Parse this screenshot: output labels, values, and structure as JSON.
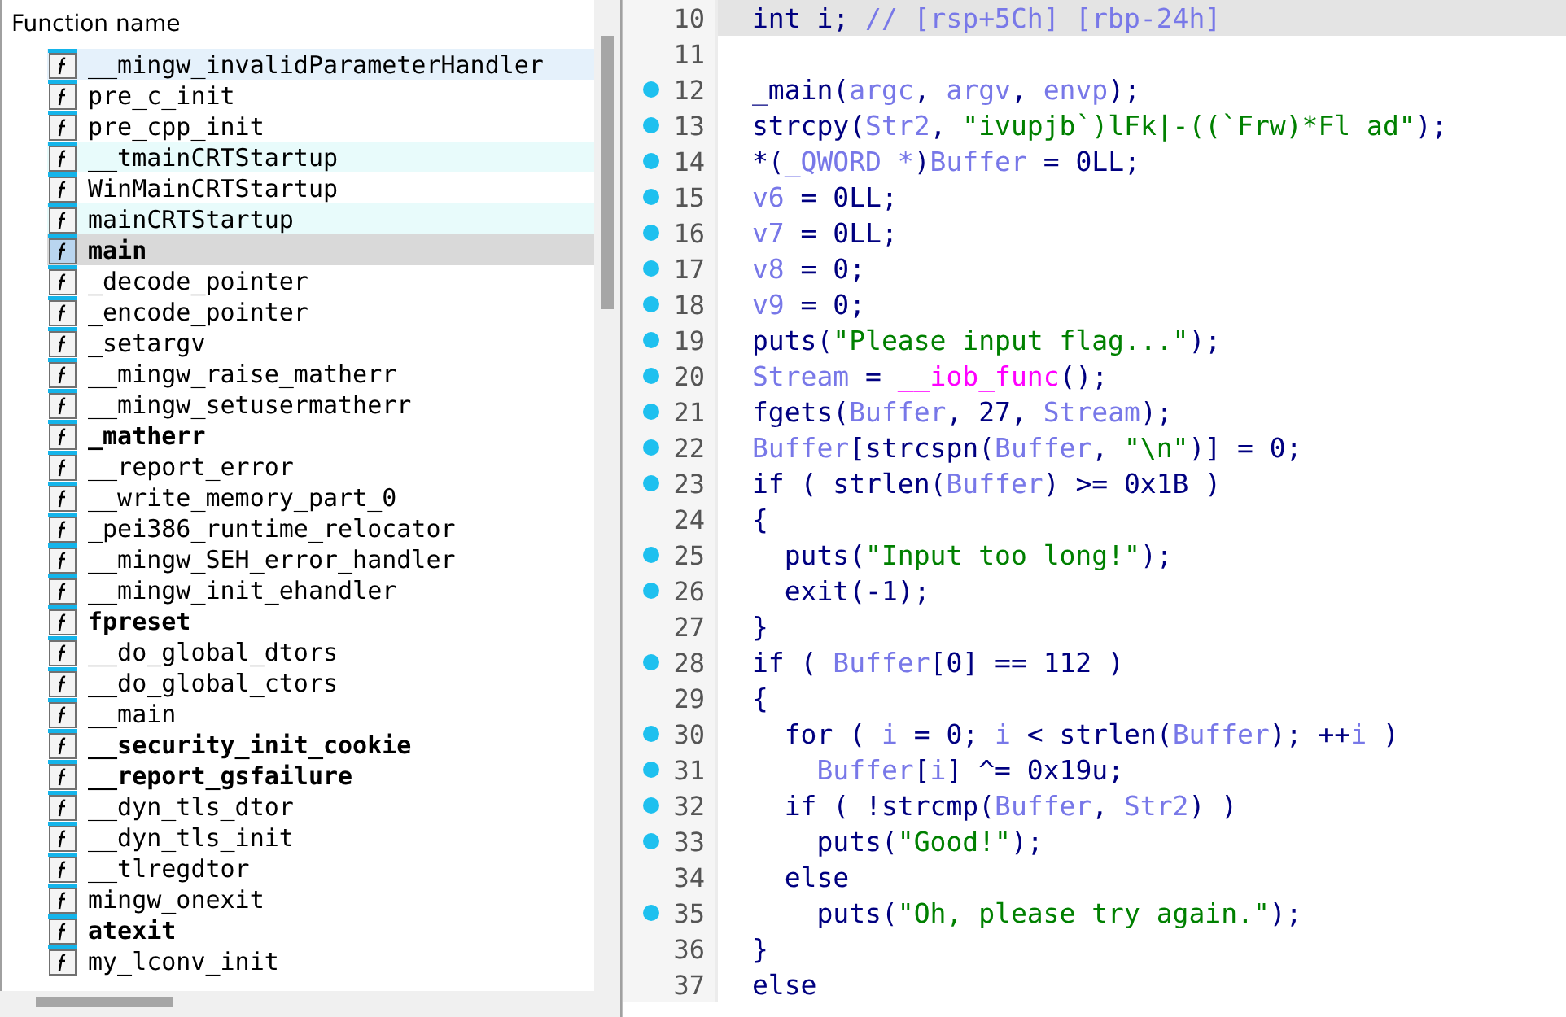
{
  "functions_panel": {
    "header": "Function name",
    "items": [
      {
        "name": "__mingw_invalidParameterHandler",
        "bold": false,
        "selected": false,
        "hovered": true,
        "highlighted": false
      },
      {
        "name": "pre_c_init",
        "bold": false,
        "selected": false,
        "hovered": false,
        "highlighted": false
      },
      {
        "name": "pre_cpp_init",
        "bold": false,
        "selected": false,
        "hovered": false,
        "highlighted": false
      },
      {
        "name": "__tmainCRTStartup",
        "bold": false,
        "selected": false,
        "hovered": false,
        "highlighted": true
      },
      {
        "name": "WinMainCRTStartup",
        "bold": false,
        "selected": false,
        "hovered": false,
        "highlighted": false
      },
      {
        "name": "mainCRTStartup",
        "bold": false,
        "selected": false,
        "hovered": false,
        "highlighted": true
      },
      {
        "name": "main",
        "bold": true,
        "selected": true,
        "hovered": false,
        "highlighted": false
      },
      {
        "name": "_decode_pointer",
        "bold": false,
        "selected": false,
        "hovered": false,
        "highlighted": false
      },
      {
        "name": "_encode_pointer",
        "bold": false,
        "selected": false,
        "hovered": false,
        "highlighted": false
      },
      {
        "name": "_setargv",
        "bold": false,
        "selected": false,
        "hovered": false,
        "highlighted": false
      },
      {
        "name": "__mingw_raise_matherr",
        "bold": false,
        "selected": false,
        "hovered": false,
        "highlighted": false
      },
      {
        "name": "__mingw_setusermatherr",
        "bold": false,
        "selected": false,
        "hovered": false,
        "highlighted": false
      },
      {
        "name": "_matherr",
        "bold": true,
        "selected": false,
        "hovered": false,
        "highlighted": false
      },
      {
        "name": "__report_error",
        "bold": false,
        "selected": false,
        "hovered": false,
        "highlighted": false
      },
      {
        "name": "__write_memory_part_0",
        "bold": false,
        "selected": false,
        "hovered": false,
        "highlighted": false
      },
      {
        "name": "_pei386_runtime_relocator",
        "bold": false,
        "selected": false,
        "hovered": false,
        "highlighted": false
      },
      {
        "name": "__mingw_SEH_error_handler",
        "bold": false,
        "selected": false,
        "hovered": false,
        "highlighted": false
      },
      {
        "name": "__mingw_init_ehandler",
        "bold": false,
        "selected": false,
        "hovered": false,
        "highlighted": false
      },
      {
        "name": "fpreset",
        "bold": true,
        "selected": false,
        "hovered": false,
        "highlighted": false
      },
      {
        "name": "__do_global_dtors",
        "bold": false,
        "selected": false,
        "hovered": false,
        "highlighted": false
      },
      {
        "name": "__do_global_ctors",
        "bold": false,
        "selected": false,
        "hovered": false,
        "highlighted": false
      },
      {
        "name": "__main",
        "bold": false,
        "selected": false,
        "hovered": false,
        "highlighted": false
      },
      {
        "name": "__security_init_cookie",
        "bold": true,
        "selected": false,
        "hovered": false,
        "highlighted": false
      },
      {
        "name": "__report_gsfailure",
        "bold": true,
        "selected": false,
        "hovered": false,
        "highlighted": false
      },
      {
        "name": "__dyn_tls_dtor",
        "bold": false,
        "selected": false,
        "hovered": false,
        "highlighted": false
      },
      {
        "name": "__dyn_tls_init",
        "bold": false,
        "selected": false,
        "hovered": false,
        "highlighted": false
      },
      {
        "name": "__tlregdtor",
        "bold": false,
        "selected": false,
        "hovered": false,
        "highlighted": false
      },
      {
        "name": "mingw_onexit",
        "bold": false,
        "selected": false,
        "hovered": false,
        "highlighted": false
      },
      {
        "name": "atexit",
        "bold": true,
        "selected": false,
        "hovered": false,
        "highlighted": false
      },
      {
        "name": "my_lconv_init",
        "bold": false,
        "selected": false,
        "hovered": false,
        "highlighted": false
      }
    ]
  },
  "pseudocode": {
    "lines": [
      {
        "number": "10",
        "dot": false,
        "current": true,
        "tokens": [
          {
            "kind": "plain",
            "text": "int i; "
          },
          {
            "kind": "comment",
            "text": "// [rsp+5Ch] [rbp-24h]"
          }
        ]
      },
      {
        "number": "11",
        "dot": false,
        "current": false
      },
      {
        "number": "12",
        "dot": true,
        "current": false,
        "tokens": [
          {
            "kind": "plain",
            "text": "_main("
          },
          {
            "kind": "var",
            "text": "argc"
          },
          {
            "kind": "plain",
            "text": ", "
          },
          {
            "kind": "var",
            "text": "argv"
          },
          {
            "kind": "plain",
            "text": ", "
          },
          {
            "kind": "var",
            "text": "envp"
          },
          {
            "kind": "plain",
            "text": ");"
          }
        ]
      },
      {
        "number": "13",
        "dot": true,
        "current": false,
        "tokens": [
          {
            "kind": "plain",
            "text": "strcpy("
          },
          {
            "kind": "var",
            "text": "Str2"
          },
          {
            "kind": "plain",
            "text": ", "
          },
          {
            "kind": "string",
            "text": "\"ivupjb`)lFk|-((`Frw)*Fl ad\""
          },
          {
            "kind": "plain",
            "text": ");"
          }
        ]
      },
      {
        "number": "14",
        "dot": true,
        "current": false,
        "tokens": [
          {
            "kind": "plain",
            "text": "*("
          },
          {
            "kind": "var",
            "text": "_QWORD *"
          },
          {
            "kind": "plain",
            "text": ")"
          },
          {
            "kind": "var",
            "text": "Buffer"
          },
          {
            "kind": "plain",
            "text": " = 0LL;"
          }
        ]
      },
      {
        "number": "15",
        "dot": true,
        "current": false,
        "tokens": [
          {
            "kind": "var",
            "text": "v6"
          },
          {
            "kind": "plain",
            "text": " = 0LL;"
          }
        ]
      },
      {
        "number": "16",
        "dot": true,
        "current": false,
        "tokens": [
          {
            "kind": "var",
            "text": "v7"
          },
          {
            "kind": "plain",
            "text": " = 0LL;"
          }
        ]
      },
      {
        "number": "17",
        "dot": true,
        "current": false,
        "tokens": [
          {
            "kind": "var",
            "text": "v8"
          },
          {
            "kind": "plain",
            "text": " = 0;"
          }
        ]
      },
      {
        "number": "18",
        "dot": true,
        "current": false,
        "tokens": [
          {
            "kind": "var",
            "text": "v9"
          },
          {
            "kind": "plain",
            "text": " = 0;"
          }
        ]
      },
      {
        "number": "19",
        "dot": true,
        "current": false,
        "tokens": [
          {
            "kind": "plain",
            "text": "puts("
          },
          {
            "kind": "string",
            "text": "\"Please input flag...\""
          },
          {
            "kind": "plain",
            "text": ");"
          }
        ]
      },
      {
        "number": "20",
        "dot": true,
        "current": false,
        "tokens": [
          {
            "kind": "var",
            "text": "Stream"
          },
          {
            "kind": "plain",
            "text": " = "
          },
          {
            "kind": "func",
            "text": "__iob_func"
          },
          {
            "kind": "plain",
            "text": "();"
          }
        ]
      },
      {
        "number": "21",
        "dot": true,
        "current": false,
        "tokens": [
          {
            "kind": "plain",
            "text": "fgets("
          },
          {
            "kind": "var",
            "text": "Buffer"
          },
          {
            "kind": "plain",
            "text": ", 27, "
          },
          {
            "kind": "var",
            "text": "Stream"
          },
          {
            "kind": "plain",
            "text": ");"
          }
        ]
      },
      {
        "number": "22",
        "dot": true,
        "current": false,
        "tokens": [
          {
            "kind": "var",
            "text": "Buffer"
          },
          {
            "kind": "plain",
            "text": "[strcspn("
          },
          {
            "kind": "var",
            "text": "Buffer"
          },
          {
            "kind": "plain",
            "text": ", "
          },
          {
            "kind": "string",
            "text": "\"\\n\""
          },
          {
            "kind": "plain",
            "text": ")] = 0;"
          }
        ]
      },
      {
        "number": "23",
        "dot": true,
        "current": false,
        "tokens": [
          {
            "kind": "plain",
            "text": "if ( strlen("
          },
          {
            "kind": "var",
            "text": "Buffer"
          },
          {
            "kind": "plain",
            "text": ") >= 0x1B )"
          }
        ]
      },
      {
        "number": "24",
        "dot": false,
        "current": false,
        "tokens": [
          {
            "kind": "plain",
            "text": "{"
          }
        ]
      },
      {
        "number": "25",
        "dot": true,
        "current": false,
        "tokens": [
          {
            "kind": "plain",
            "text": "  puts("
          },
          {
            "kind": "string",
            "text": "\"Input too long!\""
          },
          {
            "kind": "plain",
            "text": ");"
          }
        ]
      },
      {
        "number": "26",
        "dot": true,
        "current": false,
        "tokens": [
          {
            "kind": "plain",
            "text": "  exit(-1);"
          }
        ]
      },
      {
        "number": "27",
        "dot": false,
        "current": false,
        "tokens": [
          {
            "kind": "plain",
            "text": "}"
          }
        ]
      },
      {
        "number": "28",
        "dot": true,
        "current": false,
        "tokens": [
          {
            "kind": "plain",
            "text": "if ( "
          },
          {
            "kind": "var",
            "text": "Buffer"
          },
          {
            "kind": "plain",
            "text": "[0] == 112 )"
          }
        ]
      },
      {
        "number": "29",
        "dot": false,
        "current": false,
        "tokens": [
          {
            "kind": "plain",
            "text": "{"
          }
        ]
      },
      {
        "number": "30",
        "dot": true,
        "current": false,
        "tokens": [
          {
            "kind": "plain",
            "text": "  for ( "
          },
          {
            "kind": "var",
            "text": "i"
          },
          {
            "kind": "plain",
            "text": " = 0; "
          },
          {
            "kind": "var",
            "text": "i"
          },
          {
            "kind": "plain",
            "text": " < strlen("
          },
          {
            "kind": "var",
            "text": "Buffer"
          },
          {
            "kind": "plain",
            "text": "); ++"
          },
          {
            "kind": "var",
            "text": "i"
          },
          {
            "kind": "plain",
            "text": " )"
          }
        ]
      },
      {
        "number": "31",
        "dot": true,
        "current": false,
        "tokens": [
          {
            "kind": "var",
            "text": "    Buffer"
          },
          {
            "kind": "plain",
            "text": "["
          },
          {
            "kind": "var",
            "text": "i"
          },
          {
            "kind": "plain",
            "text": "] ^= 0x19u;"
          }
        ]
      },
      {
        "number": "32",
        "dot": true,
        "current": false,
        "tokens": [
          {
            "kind": "plain",
            "text": "  if ( !strcmp("
          },
          {
            "kind": "var",
            "text": "Buffer"
          },
          {
            "kind": "plain",
            "text": ", "
          },
          {
            "kind": "var",
            "text": "Str2"
          },
          {
            "kind": "plain",
            "text": ") )"
          }
        ]
      },
      {
        "number": "33",
        "dot": true,
        "current": false,
        "tokens": [
          {
            "kind": "plain",
            "text": "    puts("
          },
          {
            "kind": "string",
            "text": "\"Good!\""
          },
          {
            "kind": "plain",
            "text": ");"
          }
        ]
      },
      {
        "number": "34",
        "dot": false,
        "current": false,
        "tokens": [
          {
            "kind": "plain",
            "text": "  else"
          }
        ]
      },
      {
        "number": "35",
        "dot": true,
        "current": false,
        "tokens": [
          {
            "kind": "plain",
            "text": "    puts("
          },
          {
            "kind": "string",
            "text": "\"Oh, please try again.\""
          },
          {
            "kind": "plain",
            "text": ");"
          }
        ]
      },
      {
        "number": "36",
        "dot": false,
        "current": false,
        "tokens": [
          {
            "kind": "plain",
            "text": "}"
          }
        ]
      },
      {
        "number": "37",
        "dot": false,
        "current": false,
        "tokens": [
          {
            "kind": "plain",
            "text": "else"
          }
        ]
      }
    ]
  }
}
